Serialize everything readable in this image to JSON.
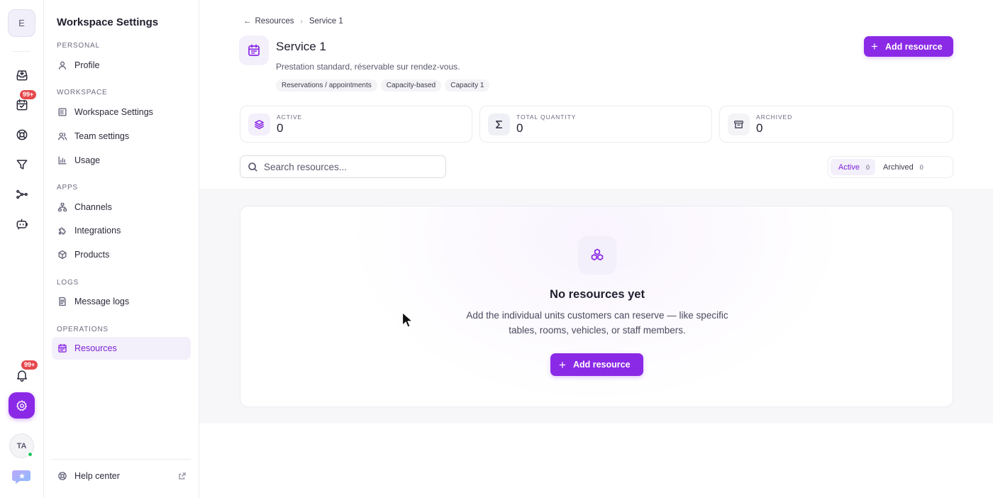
{
  "rail": {
    "workspace_initial": "E",
    "calendar_badge": "99+",
    "notifications_badge": "99+",
    "user_initials": "TA"
  },
  "sidebar": {
    "title": "Workspace Settings",
    "sections": {
      "personal": "PERSONAL",
      "workspace": "WORKSPACE",
      "apps": "APPS",
      "logs": "LOGS",
      "operations": "OPERATIONS"
    },
    "items": {
      "profile": "Profile",
      "workspace_settings": "Workspace Settings",
      "team_settings": "Team settings",
      "usage": "Usage",
      "channels": "Channels",
      "integrations": "Integrations",
      "products": "Products",
      "message_logs": "Message logs",
      "resources": "Resources"
    },
    "help_center": "Help center"
  },
  "breadcrumb": {
    "back_arrow": "←",
    "parent": "Resources",
    "separator": "›",
    "current": "Service 1"
  },
  "header": {
    "title": "Service 1",
    "description": "Prestation standard, réservable sur rendez-vous.",
    "tags": [
      "Reservations / appointments",
      "Capacity-based",
      "Capacity 1"
    ],
    "add_button": "Add resource"
  },
  "stats": [
    {
      "label": "ACTIVE",
      "value": "0",
      "icon": "layers-icon"
    },
    {
      "label": "TOTAL QUANTITY",
      "value": "0",
      "icon": "sigma-icon"
    },
    {
      "label": "ARCHIVED",
      "value": "0",
      "icon": "archive-icon"
    }
  ],
  "search": {
    "placeholder": "Search resources..."
  },
  "filter": {
    "active_label": "Active",
    "active_count": "0",
    "archived_label": "Archived",
    "archived_count": "0"
  },
  "empty_state": {
    "title": "No resources yet",
    "description": "Add the individual units customers can reserve — like specific tables, rooms, vehicles, or staff members.",
    "button": "Add resource"
  },
  "colors": {
    "accent": "#8b2ae6",
    "accent_soft": "#f3effb",
    "badge_red": "#e5484d",
    "online": "#22c55e"
  }
}
